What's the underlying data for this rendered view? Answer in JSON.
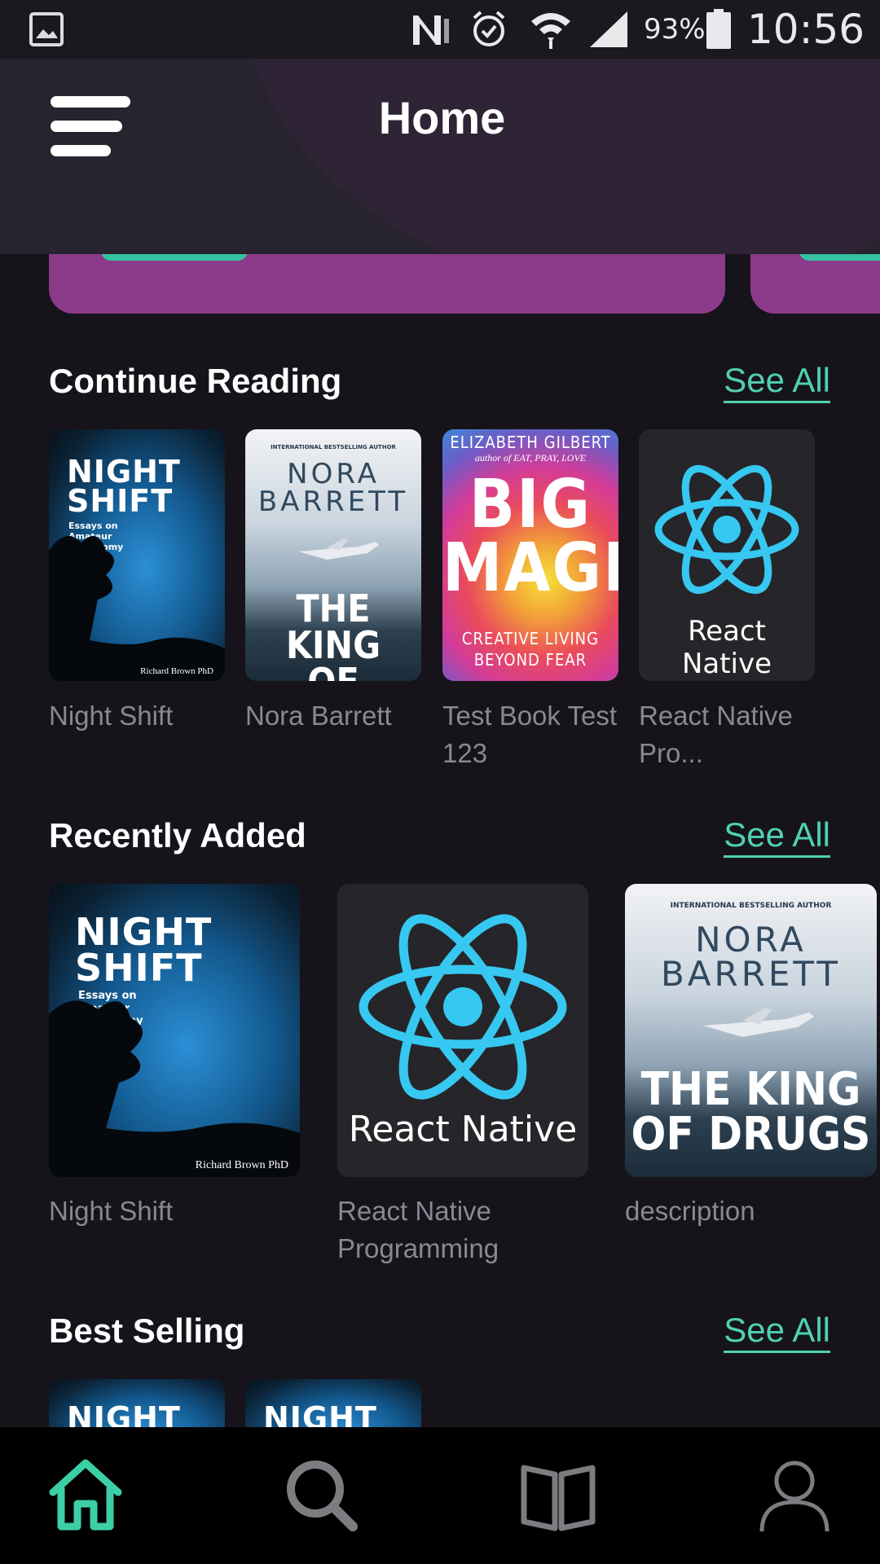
{
  "status_bar": {
    "battery": "93%",
    "time": "10:56",
    "icons": [
      "gallery-icon",
      "nfc-icon",
      "alarm-icon",
      "wifi-icon",
      "signal-icon",
      "battery-icon"
    ]
  },
  "header": {
    "title": "Home",
    "menu_icon": "menu-icon"
  },
  "sections": [
    {
      "title": "Continue Reading",
      "see_all": "See All",
      "books": [
        {
          "cover": "night-shift",
          "label": "Night Shift"
        },
        {
          "cover": "nora-barrett",
          "label": "Nora Barrett"
        },
        {
          "cover": "big-magic",
          "label": "Test Book Test 123"
        },
        {
          "cover": "react-native",
          "label": "React Native Pro..."
        }
      ]
    },
    {
      "title": "Recently Added",
      "see_all": "See All",
      "books": [
        {
          "cover": "night-shift",
          "label": "Night Shift"
        },
        {
          "cover": "react-native",
          "label": "React Native Programming"
        },
        {
          "cover": "nora-barrett",
          "label": "description"
        }
      ]
    },
    {
      "title": "Best Selling",
      "see_all": "See All",
      "books": [
        {
          "cover": "night-shift"
        },
        {
          "cover": "night-shift"
        }
      ]
    }
  ],
  "covers": {
    "night_shift": {
      "title_line1": "NIGHT",
      "title_line2": "SHIFT",
      "subtitle": "Essays on Amateur Astronomy",
      "author": "Richard Brown PhD"
    },
    "nora_barrett": {
      "top": "INTERNATIONAL BESTSELLING AUTHOR",
      "name_line1": "NORA",
      "name_line2": "BARRETT",
      "title_line1": "THE KING",
      "title_line2": "OF DRUGS"
    },
    "big_magic": {
      "author": "ELIZABETH GILBERT",
      "author_note": "author of EAT, PRAY, LOVE",
      "title_line1": "BIG",
      "title_line2": "MAGIC",
      "tagline_line1": "CREATIVE LIVING",
      "tagline_line2": "BEYOND FEAR"
    },
    "react_native": {
      "label": "React Native"
    }
  },
  "bottom_nav": [
    {
      "icon": "home-icon",
      "active": true
    },
    {
      "icon": "search-icon",
      "active": false
    },
    {
      "icon": "book-icon",
      "active": false
    },
    {
      "icon": "profile-icon",
      "active": false
    }
  ],
  "colors": {
    "background": "#16131b",
    "header": "#28242f",
    "accent": "#4fd1b0",
    "promo": "#8c3a8a",
    "muted_text": "#8b8893",
    "react_blue": "#36c8f0"
  }
}
